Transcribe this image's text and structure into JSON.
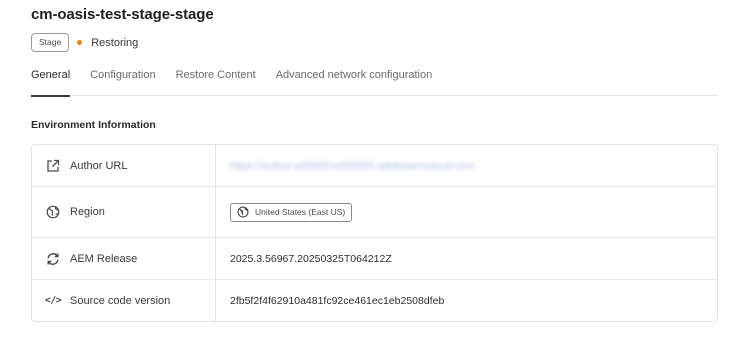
{
  "page": {
    "title": "cm-oasis-test-stage-stage"
  },
  "status": {
    "env_tag": "Stage",
    "status_label": "Restoring",
    "status_color": "#e68619"
  },
  "tabs": [
    {
      "label": "General",
      "active": true
    },
    {
      "label": "Configuration",
      "active": false
    },
    {
      "label": "Restore Content",
      "active": false
    },
    {
      "label": "Advanced network configuration",
      "active": false
    }
  ],
  "section": {
    "heading": "Environment Information"
  },
  "info": {
    "rows": [
      {
        "label": "Author URL",
        "icon": "external-link-icon",
        "value": "https://author-p00000-e000000.adobeaemcloud.com"
      },
      {
        "label": "Region",
        "icon": "globe-icon",
        "value": "United States (East US)"
      },
      {
        "label": "AEM Release",
        "icon": "refresh-icon",
        "value": "2025.3.56967.20250325T064212Z"
      },
      {
        "label": "Source code version",
        "icon": "code-icon",
        "value": "2fb5f2f4f62910a481fc92ce461ec1eb2508dfeb"
      }
    ]
  },
  "colors": {
    "link_blurred": "#a9b9e6"
  }
}
